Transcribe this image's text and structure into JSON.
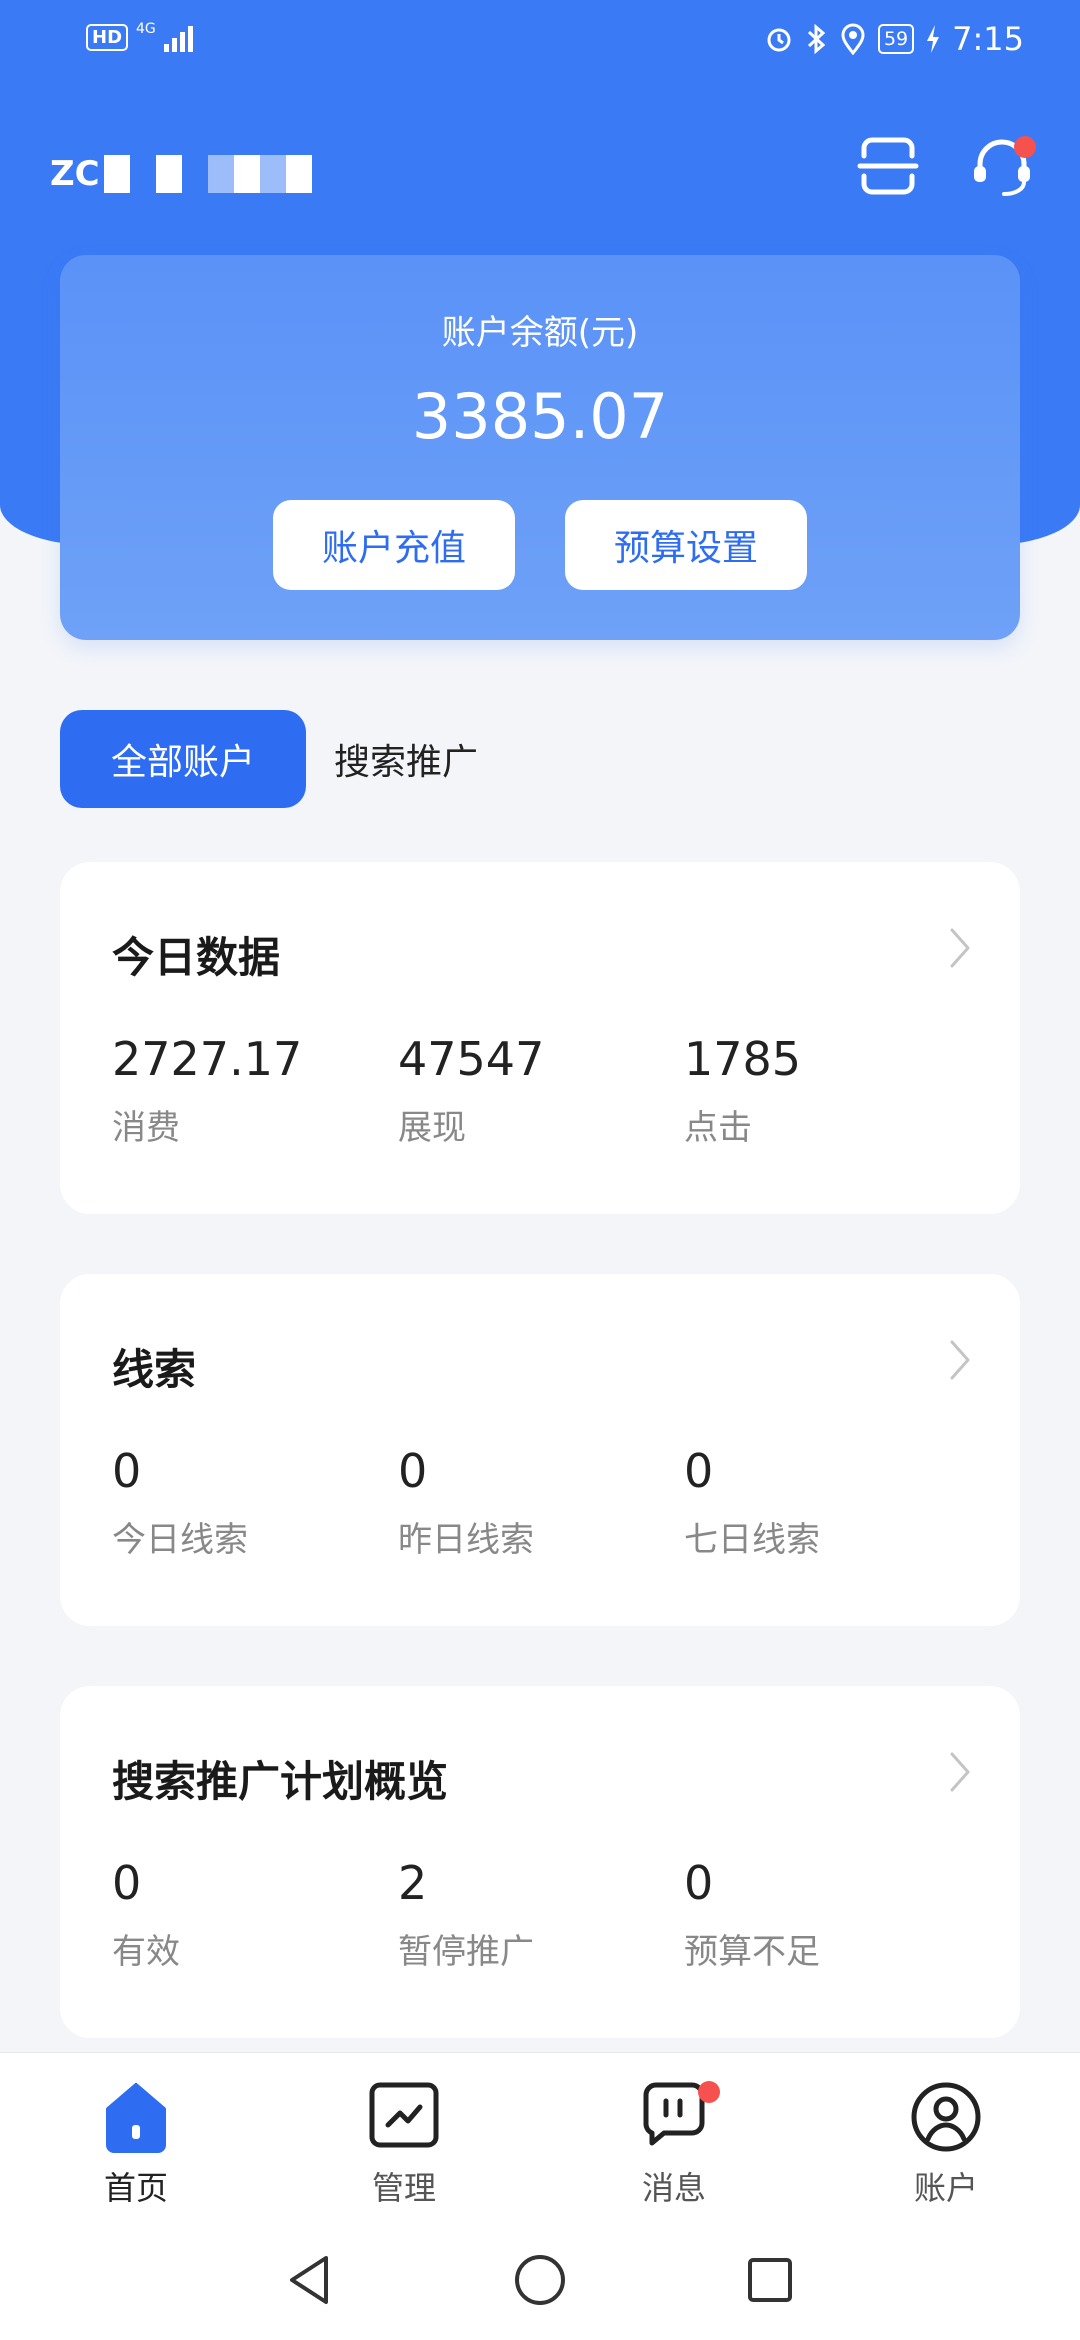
{
  "status_bar": {
    "hd": "HD",
    "network": "4G",
    "battery": "59",
    "time": "7:15"
  },
  "header": {
    "account_name_visible": "ZC",
    "scan_icon": "scan-icon",
    "service_icon": "customer-service-icon"
  },
  "balance": {
    "label": "账户余额(元)",
    "value": "3385.07",
    "recharge_label": "账户充值",
    "budget_label": "预算设置"
  },
  "tabs": [
    {
      "label": "全部账户",
      "active": true
    },
    {
      "label": "搜索推广",
      "active": false
    }
  ],
  "cards": [
    {
      "title": "今日数据",
      "metrics": [
        {
          "value": "2727.17",
          "label": "消费"
        },
        {
          "value": "47547",
          "label": "展现"
        },
        {
          "value": "1785",
          "label": "点击"
        }
      ]
    },
    {
      "title": "线索",
      "metrics": [
        {
          "value": "0",
          "label": "今日线索"
        },
        {
          "value": "0",
          "label": "昨日线索"
        },
        {
          "value": "0",
          "label": "七日线索"
        }
      ]
    },
    {
      "title": "搜索推广计划概览",
      "metrics": [
        {
          "value": "0",
          "label": "有效"
        },
        {
          "value": "2",
          "label": "暂停推广"
        },
        {
          "value": "0",
          "label": "预算不足"
        }
      ]
    }
  ],
  "tabbar": [
    {
      "label": "首页",
      "icon": "home-icon",
      "active": true
    },
    {
      "label": "管理",
      "icon": "chart-icon",
      "active": false
    },
    {
      "label": "消息",
      "icon": "message-icon",
      "active": false
    },
    {
      "label": "账户",
      "icon": "user-icon",
      "active": false
    }
  ],
  "colors": {
    "primary": "#2e6df2",
    "header": "#3b7af5",
    "badge": "#f5524f"
  }
}
